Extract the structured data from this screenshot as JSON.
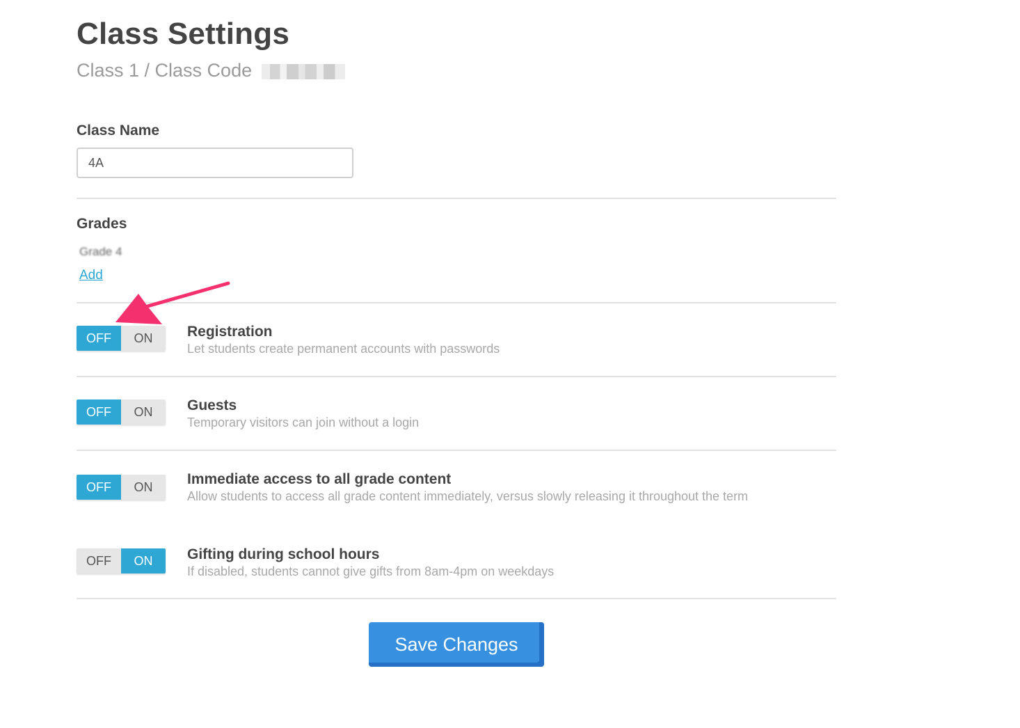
{
  "header": {
    "title": "Class Settings",
    "subtitle": "Class 1 / Class Code"
  },
  "class_name": {
    "label": "Class Name",
    "value": "4A"
  },
  "grades": {
    "label": "Grades",
    "items": [
      "Grade 4"
    ],
    "add_label": "Add"
  },
  "toggles": {
    "off_label": "OFF",
    "on_label": "ON"
  },
  "settings": [
    {
      "title": "Registration",
      "description": "Let students create permanent accounts with passwords",
      "state": "OFF"
    },
    {
      "title": "Guests",
      "description": "Temporary visitors can join without a login",
      "state": "OFF"
    },
    {
      "title": "Immediate access to all grade content",
      "description": "Allow students to access all grade content immediately, versus slowly releasing it throughout the term",
      "state": "OFF"
    },
    {
      "title": "Gifting during school hours",
      "description": "If disabled, students cannot give gifts from 8am-4pm on weekdays",
      "state": "ON"
    }
  ],
  "save_label": "Save Changes",
  "colors": {
    "accent": "#2fa7d4",
    "button": "#3891e0",
    "annotation_arrow": "#f5306f"
  }
}
